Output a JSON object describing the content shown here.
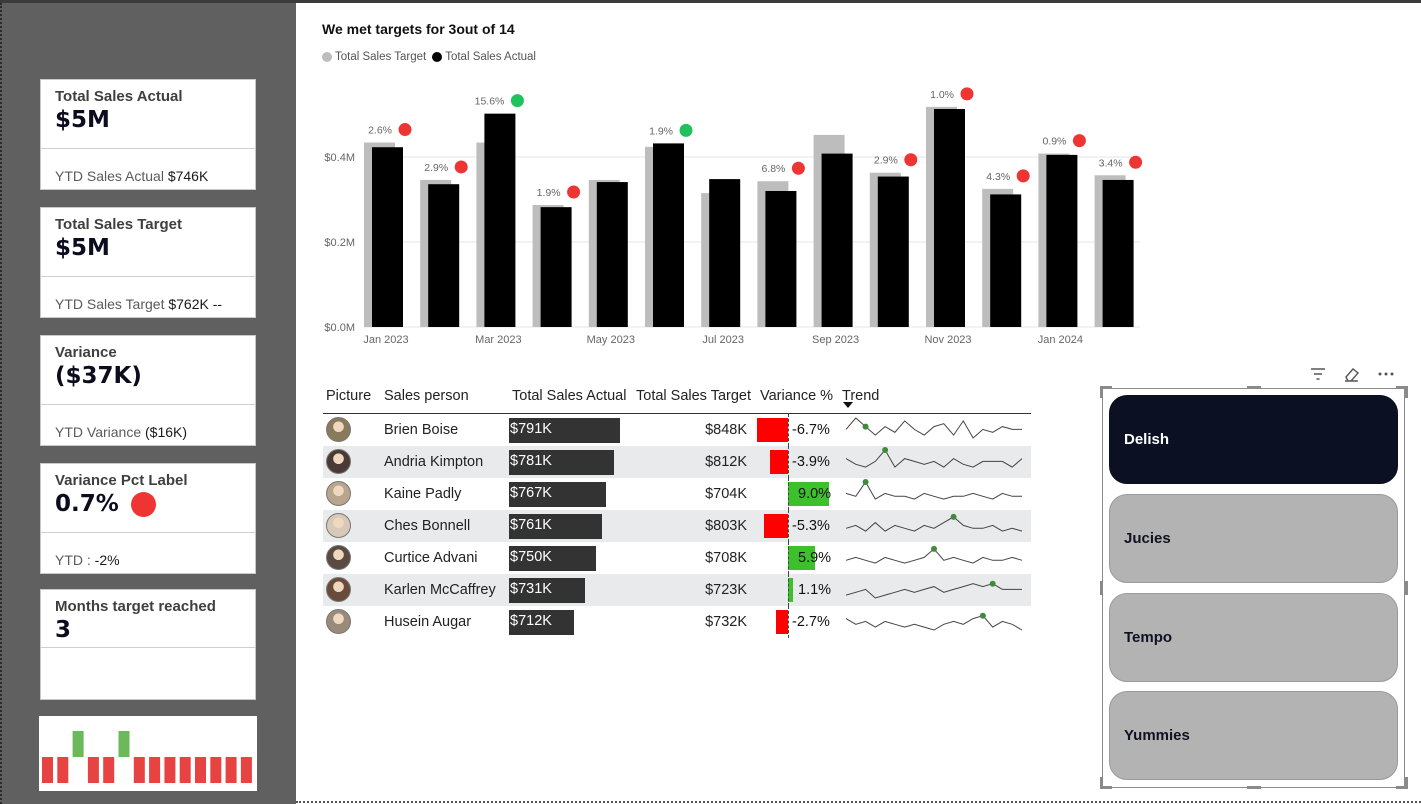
{
  "kpi_cards": [
    {
      "label": "Total Sales Actual",
      "value": "$5M",
      "sub_label": "YTD Sales Actual",
      "sub_value": "$746K"
    },
    {
      "label": "Total Sales Target",
      "value": "$5M",
      "sub_label": "YTD Sales Target",
      "sub_value": "$762K --"
    },
    {
      "label": "Variance",
      "value": "($37K)",
      "sub_label": "YTD Variance",
      "sub_value": "($16K)"
    },
    {
      "label": "Variance Pct Label",
      "value": "0.7%",
      "sub_label": "YTD :",
      "sub_value": "-2%"
    },
    {
      "label": "Months target reached",
      "value": "3",
      "sub_label": "",
      "sub_value": ""
    }
  ],
  "mini_chart": {
    "months_status": [
      "miss",
      "miss",
      "hit",
      "miss",
      "miss",
      "hit",
      "miss",
      "miss",
      "miss",
      "miss",
      "miss",
      "miss",
      "miss",
      "miss"
    ]
  },
  "chart_data": {
    "type": "bar",
    "title": "We met targets for 3out of 14",
    "legend": [
      "Total Sales Target",
      "Total Sales Actual"
    ],
    "categories": [
      "Jan 2023",
      "Feb 2023",
      "Mar 2023",
      "Apr 2023",
      "May 2023",
      "Jun 2023",
      "Jul 2023",
      "Aug 2023",
      "Sep 2023",
      "Oct 2023",
      "Nov 2023",
      "Dec 2023",
      "Jan 2024",
      "Feb 2024"
    ],
    "x_tick_labels": [
      "Jan 2023",
      "Mar 2023",
      "May 2023",
      "Jul 2023",
      "Sep 2023",
      "Nov 2023",
      "Jan 2024"
    ],
    "series": [
      {
        "name": "Total Sales Target",
        "values": [
          0.434,
          0.346,
          0.434,
          0.287,
          0.346,
          0.424,
          0.315,
          0.343,
          0.452,
          0.363,
          0.518,
          0.325,
          0.408,
          0.357
        ]
      },
      {
        "name": "Total Sales Actual",
        "values": [
          0.423,
          0.336,
          0.502,
          0.282,
          0.341,
          0.432,
          0.348,
          0.32,
          0.408,
          0.354,
          0.513,
          0.312,
          0.405,
          0.346
        ]
      }
    ],
    "data_labels": [
      "2.6%",
      "2.9%",
      "15.6%",
      "1.9%",
      "",
      "1.9%",
      "",
      "6.8%",
      "",
      "2.9%",
      "1.0%",
      "4.3%",
      "0.9%",
      "3.4%"
    ],
    "status_dots": [
      "red",
      "red",
      "green",
      "red",
      "",
      "green",
      "",
      "red",
      "",
      "red",
      "red",
      "red",
      "red",
      "red"
    ],
    "y_ticks": [
      "$0.0M",
      "$0.2M",
      "$0.4M"
    ],
    "y_tick_values": [
      0,
      0.2,
      0.4
    ],
    "ylim": [
      0,
      0.6
    ],
    "colors": {
      "target": "#bdbdbd",
      "actual": "#000000",
      "hit": "#1fc25c",
      "miss": "#ef3434"
    }
  },
  "table": {
    "headers": [
      "Picture",
      "Sales person",
      "Total Sales Actual",
      "Total Sales Target",
      "Variance %",
      "Trend"
    ],
    "rows": [
      {
        "name": "Brien Boise",
        "actual": "$791K",
        "actual_val": 791,
        "target": "$848K",
        "variance": "-6.7%",
        "variance_val": -6.7,
        "trend": [
          5,
          9,
          6,
          3,
          6,
          4,
          8,
          5,
          3,
          6,
          7,
          3,
          8,
          2,
          5,
          4,
          6,
          5,
          5
        ],
        "trend_peak": 2
      },
      {
        "name": "Andria Kimpton",
        "actual": "$781K",
        "actual_val": 781,
        "target": "$812K",
        "variance": "-3.9%",
        "variance_val": -3.9,
        "trend": [
          6,
          4,
          3,
          5,
          9,
          3,
          6,
          5,
          4,
          5,
          3,
          6,
          4,
          3,
          5,
          5,
          5,
          3,
          6
        ],
        "trend_peak": 4
      },
      {
        "name": "Kaine Padly",
        "actual": "$767K",
        "actual_val": 767,
        "target": "$704K",
        "variance": "9.0%",
        "variance_val": 9.0,
        "trend": [
          5,
          4,
          9,
          3,
          5,
          4,
          4,
          3,
          5,
          4,
          3,
          4,
          4,
          5,
          4,
          3,
          5,
          4,
          4
        ],
        "trend_peak": 2
      },
      {
        "name": "Ches Bonnell",
        "actual": "$761K",
        "actual_val": 761,
        "target": "$803K",
        "variance": "-5.3%",
        "variance_val": -5.3,
        "trend": [
          4,
          5,
          3,
          6,
          3,
          5,
          4,
          3,
          5,
          4,
          6,
          8,
          5,
          4,
          4,
          5,
          3,
          4,
          3
        ],
        "trend_peak": 11
      },
      {
        "name": "Curtice Advani",
        "actual": "$750K",
        "actual_val": 750,
        "target": "$708K",
        "variance": "5.9%",
        "variance_val": 5.9,
        "trend": [
          4,
          5,
          4,
          3,
          5,
          4,
          3,
          4,
          5,
          8,
          4,
          5,
          4,
          3,
          5,
          4,
          4,
          5,
          4
        ],
        "trend_peak": 9
      },
      {
        "name": "Karlen McCaffrey",
        "actual": "$731K",
        "actual_val": 731,
        "target": "$723K",
        "variance": "1.1%",
        "variance_val": 1.1,
        "trend": [
          3,
          4,
          5,
          2,
          3,
          4,
          5,
          4,
          5,
          6,
          4,
          5,
          6,
          7,
          6,
          7,
          5,
          5,
          5
        ],
        "trend_peak": 15
      },
      {
        "name": "Husein Augar",
        "actual": "$712K",
        "actual_val": 712,
        "target": "$732K",
        "variance": "-2.7%",
        "variance_val": -2.7,
        "trend": [
          6,
          4,
          5,
          3,
          5,
          4,
          3,
          4,
          3,
          2,
          4,
          5,
          4,
          6,
          7,
          3,
          5,
          4,
          2
        ],
        "trend_peak": 14
      }
    ],
    "avatar_colors": [
      "#8a7a5c",
      "#4a3a35",
      "#b9a48c",
      "#d8c8b8",
      "#5a4a40",
      "#6a4b3a",
      "#9a8a7a"
    ]
  },
  "slicer": {
    "items": [
      {
        "label": "Delish",
        "selected": true
      },
      {
        "label": "Jucies",
        "selected": false
      },
      {
        "label": "Tempo",
        "selected": false
      },
      {
        "label": "Yummies",
        "selected": false
      }
    ],
    "toolbar_icons": [
      "filter-icon",
      "eraser-icon",
      "more-options-icon"
    ]
  }
}
